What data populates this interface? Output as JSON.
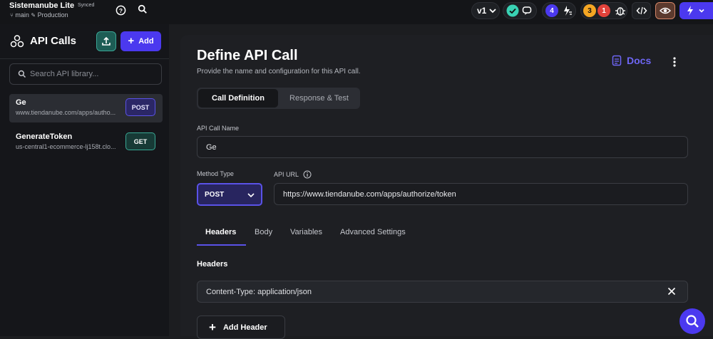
{
  "topbar": {
    "app_title": "Sistemanube Lite",
    "sync_status": "Synced",
    "branch": "main",
    "environment": "Production",
    "version": "v1",
    "collab_count": "4",
    "warning_count": "3",
    "error_count": "1"
  },
  "sidebar": {
    "title": "API Calls",
    "add_label": "Add",
    "search_placeholder": "Search API library...",
    "items": [
      {
        "name": "Ge",
        "url": "www.tiendanube.com/apps/autho...",
        "method": "POST"
      },
      {
        "name": "GenerateToken",
        "url": "us-central1-ecommerce-lj158t.clo...",
        "method": "GET"
      }
    ]
  },
  "main": {
    "title": "Define API Call",
    "subtitle": "Provide the name and configuration for this API call.",
    "docs_label": "Docs",
    "tabs": [
      "Call Definition",
      "Response & Test"
    ],
    "name_label": "API Call Name",
    "name_value": "Ge",
    "method_label": "Method Type",
    "method_value": "POST",
    "url_label": "API URL",
    "url_value": "https://www.tiendanube.com/apps/authorize/token",
    "sub_tabs": [
      "Headers",
      "Body",
      "Variables",
      "Advanced Settings"
    ],
    "headers_label": "Headers",
    "header_value": "Content-Type: application/json",
    "add_header_label": "Add Header"
  },
  "colors": {
    "accent": "#4b39ef",
    "teal": "#39a894",
    "warning": "#f5a623",
    "error": "#e2423b"
  }
}
